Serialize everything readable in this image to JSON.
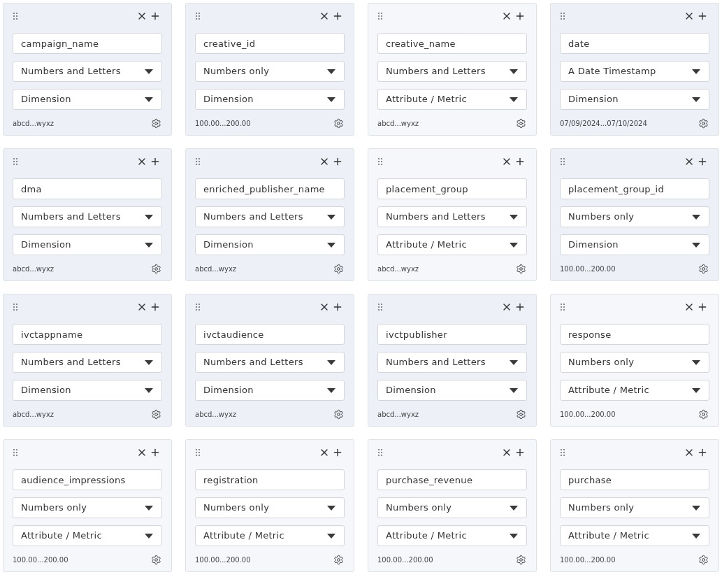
{
  "cards": [
    {
      "kind": "dimension",
      "name": "campaign_name",
      "data_type": "Numbers and Letters",
      "role": "Dimension",
      "sample": "abcd...wyxz"
    },
    {
      "kind": "dimension",
      "name": "creative_id",
      "data_type": "Numbers only",
      "role": "Dimension",
      "sample": "100.00...200.00"
    },
    {
      "kind": "metric",
      "name": "creative_name",
      "data_type": "Numbers and Letters",
      "role": "Attribute / Metric",
      "sample": "abcd...wyxz"
    },
    {
      "kind": "dimension",
      "name": "date",
      "data_type": "A Date Timestamp",
      "role": "Dimension",
      "sample": "07/09/2024...07/10/2024"
    },
    {
      "kind": "dimension",
      "name": "dma",
      "data_type": "Numbers and Letters",
      "role": "Dimension",
      "sample": "abcd...wyxz"
    },
    {
      "kind": "dimension",
      "name": "enriched_publisher_name",
      "data_type": "Numbers and Letters",
      "role": "Dimension",
      "sample": "abcd...wyxz"
    },
    {
      "kind": "metric",
      "name": "placement_group",
      "data_type": "Numbers and Letters",
      "role": "Attribute / Metric",
      "sample": "abcd...wyxz"
    },
    {
      "kind": "dimension",
      "name": "placement_group_id",
      "data_type": "Numbers only",
      "role": "Dimension",
      "sample": "100.00...200.00"
    },
    {
      "kind": "dimension",
      "name": "ivctappname",
      "data_type": "Numbers and Letters",
      "role": "Dimension",
      "sample": "abcd...wyxz"
    },
    {
      "kind": "dimension",
      "name": "ivctaudience",
      "data_type": "Numbers and Letters",
      "role": "Dimension",
      "sample": "abcd...wyxz"
    },
    {
      "kind": "dimension",
      "name": "ivctpublisher",
      "data_type": "Numbers and Letters",
      "role": "Dimension",
      "sample": "abcd...wyxz"
    },
    {
      "kind": "metric",
      "name": "response",
      "data_type": "Numbers only",
      "role": "Attribute / Metric",
      "sample": "100.00...200.00"
    },
    {
      "kind": "metric",
      "name": "audience_impressions",
      "data_type": "Numbers only",
      "role": "Attribute / Metric",
      "sample": "100.00...200.00"
    },
    {
      "kind": "metric",
      "name": "registration",
      "data_type": "Numbers only",
      "role": "Attribute / Metric",
      "sample": "100.00...200.00"
    },
    {
      "kind": "metric",
      "name": "purchase_revenue",
      "data_type": "Numbers only",
      "role": "Attribute / Metric",
      "sample": "100.00...200.00"
    },
    {
      "kind": "metric",
      "name": "purchase",
      "data_type": "Numbers only",
      "role": "Attribute / Metric",
      "sample": "100.00...200.00"
    }
  ]
}
